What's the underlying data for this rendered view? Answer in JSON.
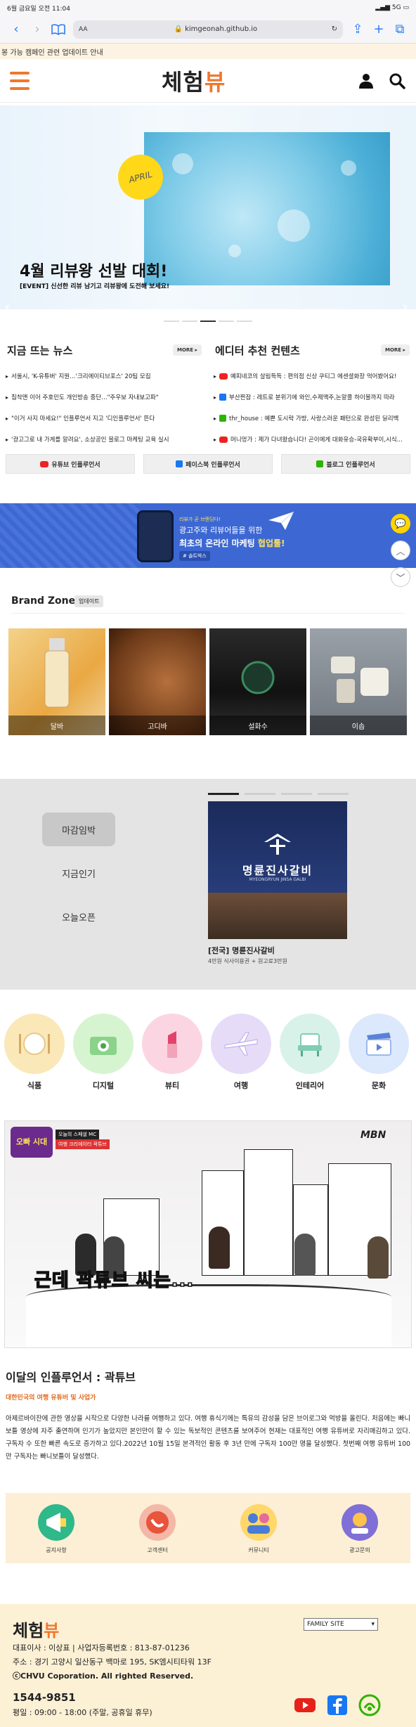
{
  "status": {
    "time": "6월 금요일 오전 11:04",
    "signal": "5G"
  },
  "browser": {
    "aa": "AA",
    "url": "kimgeonah.github.io"
  },
  "notice": "봉 가능 캠페인 관련 업데이트 안내",
  "header": {
    "logo_a": "체험",
    "logo_b": "뷰"
  },
  "banner": {
    "badge": "APRIL",
    "title": "4월 리뷰왕 선발 대회!",
    "subtitle": "[EVENT] 신선한 리뷰 남기고 리뷰왕에 도전해 보세요!",
    "slides": 5,
    "active_slide": 2
  },
  "news": {
    "title": "지금 뜨는 뉴스",
    "more": "MORE ▸",
    "items": [
      "서울시, 'K-유튜버' 지원…'크리에이티브포스' 20팀 모집",
      "침착맨 이어 주호민도 개인방송 중단…\"주우보 자내보고파\"",
      "\"이거 사지 마세요!\" 인플루언서 지고 '디인플루언서' 뜬다",
      "'광고그로 내 가게를 알려요', 소상공인 블로그 마케팅 교육 실시"
    ]
  },
  "editor": {
    "title": "에디터 추천 컨텐츠",
    "more": "MORE ▸",
    "items": [
      {
        "src": "yt",
        "text": "예피네코의 살림득득 : 편의점 신상 쿠티그 에센셜화장 먹어봤어요!"
      },
      {
        "src": "fb",
        "text": "부산찐잠 : 레트로 분위기에 와인,수제맥주,논알콜 하이볼까지 따라"
      },
      {
        "src": "bl",
        "text": "thr_house : 예쁜 도시락 가방, 사랑스러운 패턴으로 완성된 딜리백"
      },
      {
        "src": "yt",
        "text": "머니멍가 : 제가 다녀왔습니다! 곤이에게 대화유승-국유확부이,시식..."
      }
    ]
  },
  "influencer_buttons": [
    "유튜브 인플루언서",
    "페이스북 인플루언서",
    "블로그 인플루언서"
  ],
  "ad": {
    "small": "리뷰가 곧 브랜딩다!",
    "line1": "광고주와 리뷰어들을 위한",
    "line2_a": "최초의 온라인 마케팅 ",
    "line2_b": "협업툴!",
    "tag": "# 솔트박스"
  },
  "brand": {
    "title": "Brand Zone",
    "badge": "업데이트",
    "cards": [
      "달바",
      "고디바",
      "설화수",
      "이솝"
    ]
  },
  "deals": {
    "tabs": [
      "마감임박",
      "지금인기",
      "오늘오픈"
    ],
    "active_tab": 0,
    "poster_name": "명륜진사갈비",
    "poster_sub": "MYEONGRYUN JINSA GALBI",
    "item_title": "[전국] 명륜진사갈비",
    "item_desc": "4만원 식사이용권 + 원고료3만원"
  },
  "categories": [
    {
      "label": "식품",
      "color": "#fbe8b8"
    },
    {
      "label": "디지털",
      "color": "#d6f4d0"
    },
    {
      "label": "뷰티",
      "color": "#fbd6e2"
    },
    {
      "label": "여행",
      "color": "#e6dcf8"
    },
    {
      "label": "인테리어",
      "color": "#d8f2ea"
    },
    {
      "label": "문화",
      "color": "#dce8fb"
    }
  ],
  "video": {
    "badge": "오빠 시대",
    "mc": "오늘의 스페셜 MC",
    "host": "여행 크리에이터 곽튜브",
    "channel": "MBN",
    "caption_a": "근데 ",
    "caption_b": "곽튜브",
    "caption_c": " 씨는..."
  },
  "monthly": {
    "title": "이달의 인플루언서 : 곽튜브",
    "subtitle": "대한민국의 여행 유튜버 및 사업가",
    "body": "아제르바이잔에 관한 영상을 시작으로 다양한 나라를 여행하고 있다. 여행 휴식기에는 특유의 감성을 담은 브이로그와 먹방을 올린다. 처음에는 빠니보틀 영상에 자주 출연하며 인기가 높았지만 본인만이 할 수 있는 독보적인 콘텐츠를 보여주어 현재는 대표적인 여행 유튜버로 자리매김하고 있다. 구독자 수 또한 빠른 속도로 증가하고 있다.2022년 10월 15일 본격적인 활동 후 3년 만에 구독자 100만 명을 달성했다. 첫번째 여행 유튜버 100만 구독자는 빠니보틀이 달성했다."
  },
  "services": [
    "공지사항",
    "고객센터",
    "커뮤니티",
    "광고문의"
  ],
  "footer": {
    "logo_a": "체험",
    "logo_b": "뷰",
    "family": "FAMILY SITE",
    "line1": "대표이사 : 이상표 | 사업자등록번호 : 813-87-01236",
    "line2": "주소 : 경기 고양시 일산동구 백마로 195, SK엠시티타워 13F",
    "line3": "ⓒCHVU Coporation. All righted Reserved.",
    "phone": "1544-9851",
    "hours": "평일 : 09:00 - 18:00 (주말, 공휴일 휴무)"
  }
}
